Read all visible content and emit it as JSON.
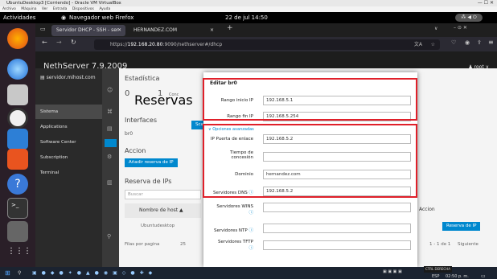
{
  "vbox": {
    "title": "UbuntuDesktop3 [Corriendo] - Oracle VM VirtualBox",
    "menu": [
      "Archivo",
      "Máquina",
      "Ver",
      "Entrada",
      "Dispositivos",
      "Ayuda"
    ],
    "ctrls": "—   ☐   ✕"
  },
  "gnome": {
    "activities": "Actividades",
    "app": "Navegador web Firefox",
    "clock": "22 de jul 14:50"
  },
  "firefox": {
    "tab1": "Servidor DHCP - SSH - ser",
    "tab1_close": "✕",
    "tab2": "HERNANDEZ.COM",
    "tab2_close": "×",
    "new_tab": "+",
    "url_prefix": "https://",
    "url_host": "192.168.20.80",
    "url_rest": ":9090/nethserver#/dhcp",
    "win_ctrls": "–   ⊙   ✕"
  },
  "nethserver": {
    "title": "NethServer 7.9.2009",
    "user": "root",
    "hostname": "servidor.mihost.com",
    "side": [
      "Sistema",
      "Applications",
      "Software Center",
      "Subscription",
      "Terminal"
    ]
  },
  "main_bg": {
    "estadistica": "Estadística",
    "reservas_num": "0",
    "reservas": "Reservas",
    "conce_num": "1",
    "conce": "Concesiones",
    "interfaces": "Interfaces",
    "br0": "br0",
    "scan": "Sca",
    "accion": "Accion",
    "anadir": "Añadir reserva de IP",
    "reserva": "Reserva de IPs",
    "buscar": "Buscar",
    "nombre_host": "Nombre de host ▲",
    "ubuntu": "Ubuntudesktop",
    "filas": "Filas por pagina",
    "filas_n": "25",
    "accion_col": "Accion",
    "reserva_btn": "Reserva de IP",
    "paginacion": "1 - 1 de 1",
    "siguiente": "Siguiente"
  },
  "dialog": {
    "title": "Editar br0",
    "rango_inicio_label": "Rango inicio IP",
    "rango_inicio": "192.168.5.1",
    "rango_fin_label": "Rango fin IP",
    "rango_fin": "192.168.5.254",
    "opciones": "Opciones avanzadas",
    "gateway_label": "IP Puerta de enlace",
    "gateway": "192.168.5.2",
    "tiempo_label_1": "Tiempo de",
    "tiempo_label_2": "concesión",
    "tiempo": "",
    "dominio_label": "Dominio",
    "dominio": "hernandez.com",
    "dns_label": "Servidores DNS",
    "dns": "192.168.5.2",
    "wins_label": "Servidores WINS",
    "wins": "",
    "ntp_label": "Servidores NTP",
    "ntp": "",
    "tftp_label": "Servidores TFTP",
    "tftp": ""
  },
  "taskbar": {
    "right": "CTRL DERECHA",
    "lang": "ESP",
    "time": "02:50 p. m."
  },
  "colors": {
    "accent": "#0088ce",
    "highlight": "#e0202a"
  }
}
